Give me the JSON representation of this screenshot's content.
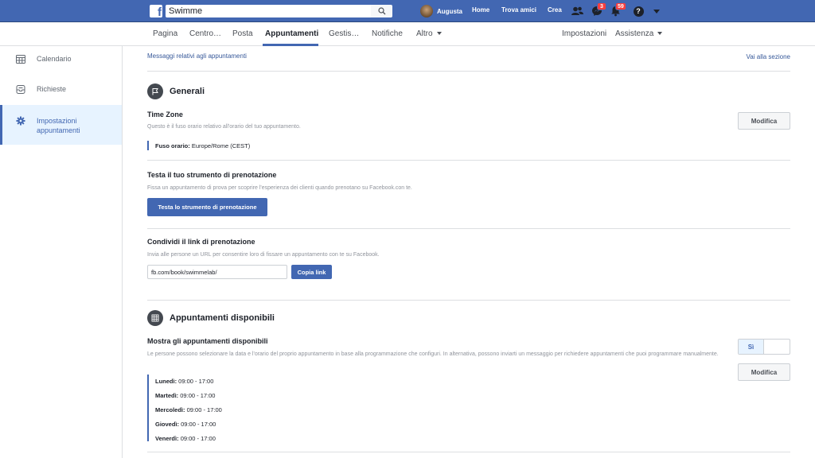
{
  "topbar": {
    "logo_letter": "f",
    "search_value": "Swimme",
    "profile_name": "Augusta",
    "links": {
      "home": "Home",
      "find_friends": "Trova amici",
      "create": "Crea"
    },
    "messages_badge": "3",
    "notifications_badge": "59",
    "help_glyph": "?"
  },
  "tabs": {
    "items": [
      "Pagina",
      "Centro…",
      "Posta",
      "Appuntamenti",
      "Gestis…",
      "Notifiche",
      "Altro"
    ],
    "right": [
      "Impostazioni",
      "Assistenza"
    ],
    "active": "Appuntamenti"
  },
  "sidebar": {
    "items": [
      {
        "label": "Calendario",
        "icon": "calendar-icon"
      },
      {
        "label": "Richieste",
        "icon": "inbox-icon"
      },
      {
        "label": "Impostazioni appuntamenti",
        "icon": "gear-icon"
      }
    ]
  },
  "main": {
    "top_link": "Messaggi relativi agli appuntamenti",
    "go_to_section": "Vai alla sezione",
    "general": {
      "title": "Generali",
      "timezone": {
        "title": "Time Zone",
        "desc": "Questo è il fuso orario relativo all'orario del tuo appuntamento.",
        "key": "Fuso orario:",
        "value": "Europe/Rome (CEST)",
        "edit_label": "Modifica"
      },
      "test_tool": {
        "title": "Testa il tuo strumento di prenotazione",
        "desc": "Fissa un appuntamento di prova per scoprire l'esperienza dei clienti quando prenotano su Facebook.con te.",
        "button": "Testa lo strumento di prenotazione"
      },
      "share_link": {
        "title": "Condividi il link di prenotazione",
        "desc": "Invia alle persone un URL per consentire loro di fissare un appuntamento con te su Facebook.",
        "url": "fb.com/book/swimmelab/",
        "copy_label": "Copia link"
      }
    },
    "availability": {
      "title": "Appuntamenti disponibili",
      "show": {
        "title": "Mostra gli appuntamenti disponibili",
        "desc": "Le persone possono selezionare la data e l'orario del proprio appuntamento in base alla programmazione che configuri. In alternativa, possono inviarti un messaggio per richiedere appuntamenti che puoi programmare manualmente.",
        "toggle_on": "Sì",
        "edit_label": "Modifica"
      },
      "schedule": [
        {
          "day": "Lunedì:",
          "hours": "09:00 - 17:00"
        },
        {
          "day": "Martedì:",
          "hours": "09:00 - 17:00"
        },
        {
          "day": "Mercoledì:",
          "hours": "09:00 - 17:00"
        },
        {
          "day": "Giovedì:",
          "hours": "09:00 - 17:00"
        },
        {
          "day": "Venerdì:",
          "hours": "09:00 - 17:00"
        }
      ]
    }
  },
  "colors": {
    "brand": "#4267b2",
    "link": "#365899",
    "badge": "#fa3e3e",
    "active_bg": "#e7f3ff"
  }
}
